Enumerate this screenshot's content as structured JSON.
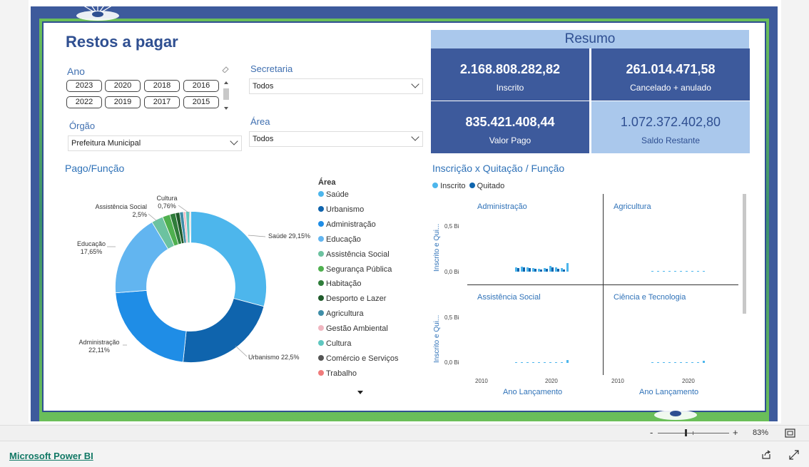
{
  "report": {
    "title": "Restos a pagar"
  },
  "filters": {
    "ano_label": "Ano",
    "years": [
      "2023",
      "2020",
      "2018",
      "2016",
      "2022",
      "2019",
      "2017",
      "2015"
    ],
    "secretaria_label": "Secretaria",
    "secretaria_value": "Todos",
    "area_label": "Área",
    "area_value": "Todos",
    "orgao_label": "Órgão",
    "orgao_value": "Prefeitura Municipal"
  },
  "resumo": {
    "title": "Resumo",
    "inscrito_value": "2.168.808.282,82",
    "inscrito_label": "Inscrito",
    "cancelado_value": "261.014.471,58",
    "cancelado_label": "Cancelado + anulado",
    "pago_value": "835.421.408,44",
    "pago_label": "Valor Pago",
    "saldo_value": "1.072.372.402,80",
    "saldo_label": "Saldo Restante"
  },
  "donut": {
    "title": "Pago/Função",
    "legend_title": "Área",
    "legend": [
      {
        "label": "Saúde",
        "color": "#4db6ec"
      },
      {
        "label": "Urbanismo",
        "color": "#0f64ad"
      },
      {
        "label": "Administração",
        "color": "#1f8de6"
      },
      {
        "label": "Educação",
        "color": "#62b5f0"
      },
      {
        "label": "Assistência Social",
        "color": "#6cc2a0"
      },
      {
        "label": "Segurança Pública",
        "color": "#4fb04f"
      },
      {
        "label": "Habitação",
        "color": "#2f7d3a"
      },
      {
        "label": "Desporto e Lazer",
        "color": "#1f5a2a"
      },
      {
        "label": "Agricultura",
        "color": "#3f8ea8"
      },
      {
        "label": "Gestão Ambiental",
        "color": "#f0b6c0"
      },
      {
        "label": "Cultura",
        "color": "#5fc7c0"
      },
      {
        "label": "Comércio e Serviços",
        "color": "#555555"
      },
      {
        "label": "Trabalho",
        "color": "#f07b7b"
      }
    ],
    "labels": {
      "saude": "Saúde 29,15%",
      "urbanismo": "Urbanismo 22,5%",
      "administracao": "Administração",
      "administracao_pct": "22,11%",
      "educacao": "Educação",
      "educacao_pct": "17,65%",
      "assistencia": "Assistência Social",
      "assistencia_pct": "2,5%",
      "cultura": "Cultura",
      "cultura_pct": "0,76%"
    }
  },
  "chart_data": {
    "type": "pie",
    "title": "Pago/Função",
    "slices": [
      {
        "label": "Saúde",
        "value": 29.15,
        "color": "#4db6ec"
      },
      {
        "label": "Urbanismo",
        "value": 22.5,
        "color": "#0f64ad"
      },
      {
        "label": "Administração",
        "value": 22.11,
        "color": "#1f8de6"
      },
      {
        "label": "Educação",
        "value": 17.65,
        "color": "#62b5f0"
      },
      {
        "label": "Assistência Social",
        "value": 2.5,
        "color": "#6cc2a0"
      },
      {
        "label": "Segurança Pública",
        "value": 1.6,
        "color": "#4fb04f"
      },
      {
        "label": "Habitação",
        "value": 1.2,
        "color": "#2f7d3a"
      },
      {
        "label": "Desporto e Lazer",
        "value": 0.9,
        "color": "#1f5a2a"
      },
      {
        "label": "Agricultura",
        "value": 0.8,
        "color": "#3f8ea8"
      },
      {
        "label": "Gestão Ambiental",
        "value": 0.5,
        "color": "#f0b6c0"
      },
      {
        "label": "Cultura",
        "value": 0.76,
        "color": "#5fc7c0"
      },
      {
        "label": "Comércio e Serviços",
        "value": 0.2,
        "color": "#555555"
      },
      {
        "label": "Trabalho",
        "value": 0.13,
        "color": "#f07b7b"
      }
    ]
  },
  "small_multiples": {
    "title": "Inscrição x Quitação / Função",
    "legend_inscrito": "Inscrito",
    "legend_quitado": "Quitado",
    "color_inscrito": "#4db6ec",
    "color_quitado": "#0f64ad",
    "y_axis_label": "Inscrito e Qui...",
    "x_axis_label": "Ano Lançamento",
    "y_tick_high": "0,5 Bi",
    "y_tick_low": "0,0 Bi",
    "x_tick_2010": "2010",
    "x_tick_2020": "2020",
    "panels": [
      "Administração",
      "Agricultura",
      "Assistência Social",
      "Ciência e Tecnologia"
    ]
  },
  "footer": {
    "zoom": "83%",
    "zoom_minus": "-",
    "zoom_plus": "+",
    "brand": "Microsoft Power BI"
  }
}
